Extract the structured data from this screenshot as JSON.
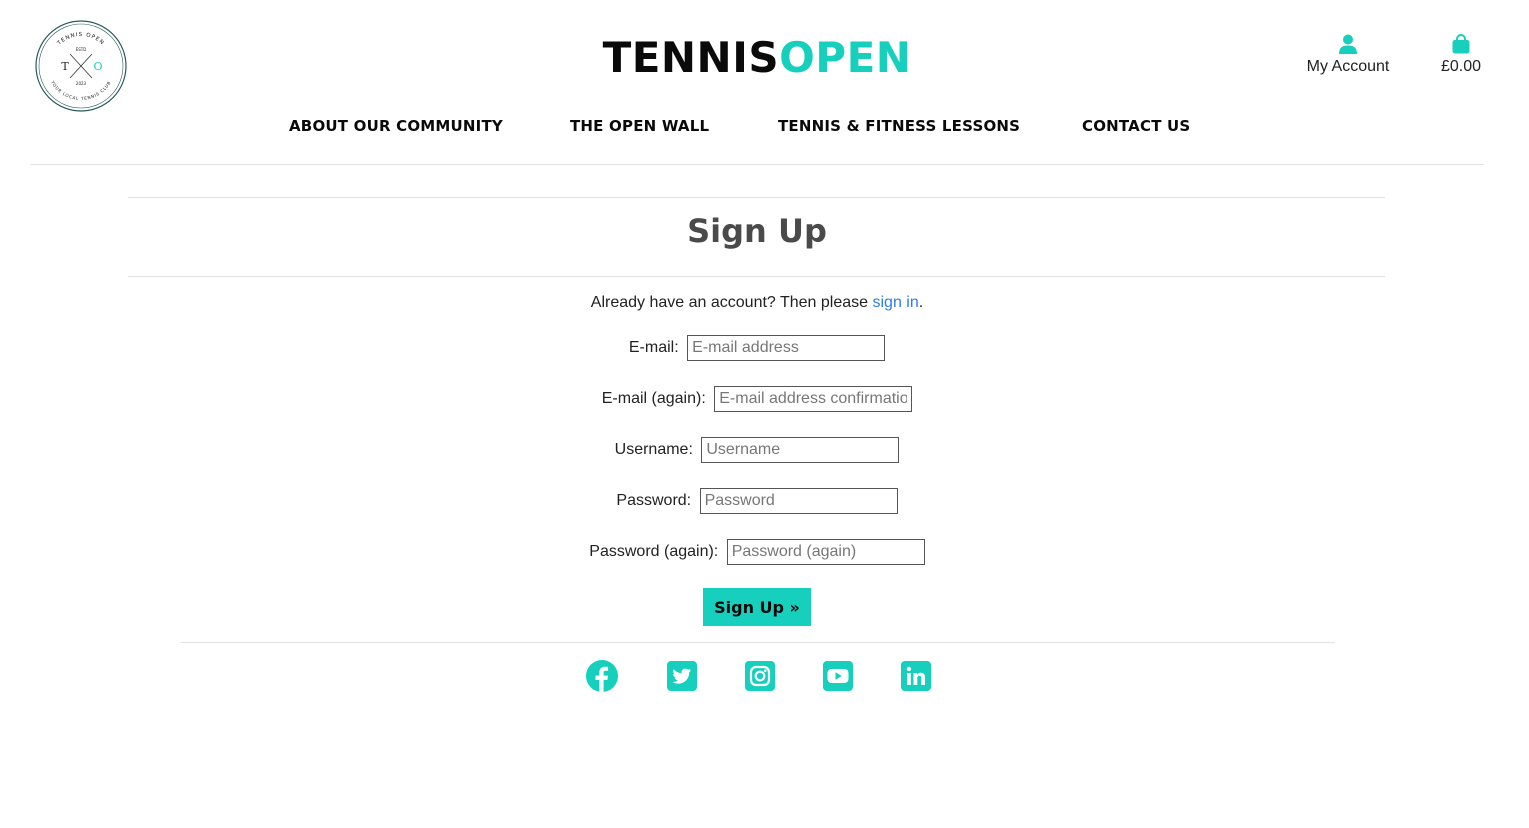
{
  "logo": {
    "ring_text": "TENNIS OPEN",
    "estd": "ESTD",
    "initial_left": "T",
    "initial_right": "O",
    "year": "2023",
    "bottom_text": "YOUR LOCAL TENNIS CLUB"
  },
  "brand": {
    "part1": "TENNIS",
    "part2": "OPEN"
  },
  "header": {
    "account_label": "My Account",
    "account_icon": "user-icon",
    "bag_total": "£0.00",
    "bag_icon": "shopping-bag-icon"
  },
  "nav": {
    "items": [
      "ABOUT OUR COMMUNITY",
      "THE OPEN WALL",
      "TENNIS & FITNESS LESSONS",
      "CONTACT US"
    ]
  },
  "page": {
    "title": "Sign Up",
    "already_prefix": "Already have an account? Then please ",
    "sign_in_link": "sign in",
    "already_suffix": "."
  },
  "form": {
    "fields": [
      {
        "label": "E-mail:",
        "placeholder": "E-mail address"
      },
      {
        "label": "E-mail (again):",
        "placeholder": "E-mail address confirmation"
      },
      {
        "label": "Username:",
        "placeholder": "Username"
      },
      {
        "label": "Password:",
        "placeholder": "Password"
      },
      {
        "label": "Password (again):",
        "placeholder": "Password (again)"
      }
    ],
    "submit_label": "Sign Up »"
  },
  "footer": {
    "social": [
      "facebook-icon",
      "twitter-icon",
      "instagram-icon",
      "youtube-icon",
      "linkedin-icon"
    ]
  },
  "colors": {
    "accent": "#16d0bd",
    "link": "#2f7be8",
    "title": "#4a4a4a"
  }
}
